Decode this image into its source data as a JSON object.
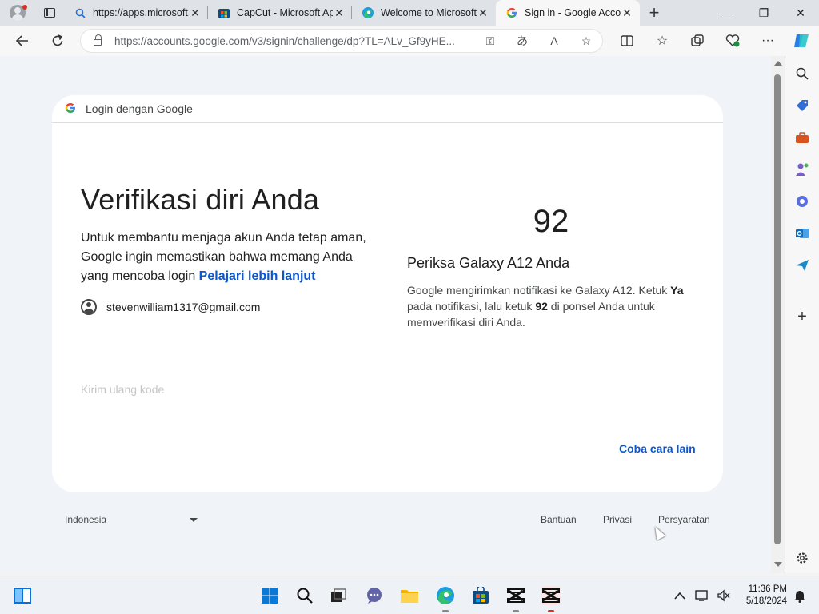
{
  "browser": {
    "tabs": [
      {
        "title": "https://apps.microsoft.com",
        "favicon": "search-icon"
      },
      {
        "title": "CapCut - Microsoft Apps",
        "favicon": "store-icon"
      },
      {
        "title": "Welcome to Microsoft Edge",
        "favicon": "edge-icon"
      },
      {
        "title": "Sign in - Google Accounts",
        "favicon": "google-icon",
        "active": true
      }
    ],
    "address": "https://accounts.google.com/v3/signin/challenge/dp?TL=ALv_Gf9yHE..."
  },
  "page": {
    "header": {
      "brand": "G",
      "title": "Login dengan Google"
    },
    "heading": "Verifikasi diri Anda",
    "description": "Untuk membantu menjaga akun Anda tetap aman, Google ingin memastikan bahwa memang Anda yang mencoba login",
    "learn_more": "Pelajari lebih lanjut",
    "email": "stevenwilliam1317@gmail.com",
    "resend": "Kirim ulang kode",
    "code": "92",
    "check_title": "Periksa Galaxy A12 Anda",
    "check_desc": {
      "p1": "Google mengirimkan notifikasi ke Galaxy A12. Ketuk ",
      "b1": "Ya",
      "p2": " pada notifikasi, lalu ketuk ",
      "b2": "92",
      "p3": " di ponsel Anda untuk memverifikasi diri Anda."
    },
    "try_other": "Coba cara lain",
    "footer": {
      "language": "Indonesia",
      "help": "Bantuan",
      "privacy": "Privasi",
      "terms": "Persyaratan"
    }
  },
  "taskbar": {
    "time": "11:36 PM",
    "date": "5/18/2024"
  },
  "colors": {
    "accent": "#0b57d0",
    "page_bg": "#f0f4f9",
    "google_blue": "#4285f4"
  }
}
